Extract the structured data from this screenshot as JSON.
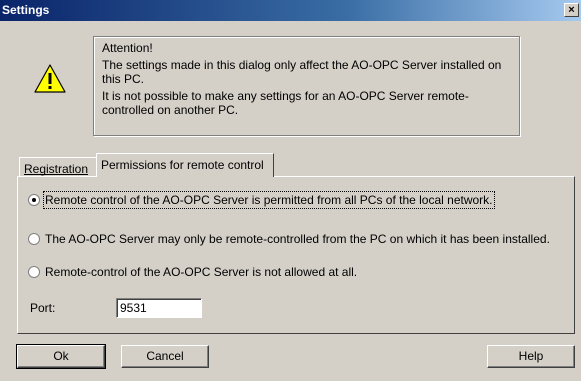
{
  "window": {
    "title": "Settings",
    "close_symbol": "×"
  },
  "attention": {
    "heading": "Attention!",
    "line1": "The settings made in this dialog only affect the AO-OPC Server installed on this PC.",
    "line2": "It is not possible to make any settings for an AO-OPC Server remote-controlled on another PC."
  },
  "tabs": [
    {
      "label": "Registration",
      "accel": "R"
    },
    {
      "label": "Permissions for remote control",
      "accel": "P"
    }
  ],
  "options": [
    {
      "label": "Remote control of the AO-OPC Server is permitted from all PCs of the local network.",
      "checked": true
    },
    {
      "label": "The AO-OPC Server may only be remote-controlled from the PC on which it has been installed.",
      "checked": false
    },
    {
      "label": "Remote-control of the AO-OPC Server is not allowed at all.",
      "checked": false
    }
  ],
  "port": {
    "label": "Port:",
    "value": "9531"
  },
  "buttons": {
    "ok": "Ok",
    "cancel": "Cancel",
    "help": "Help"
  }
}
